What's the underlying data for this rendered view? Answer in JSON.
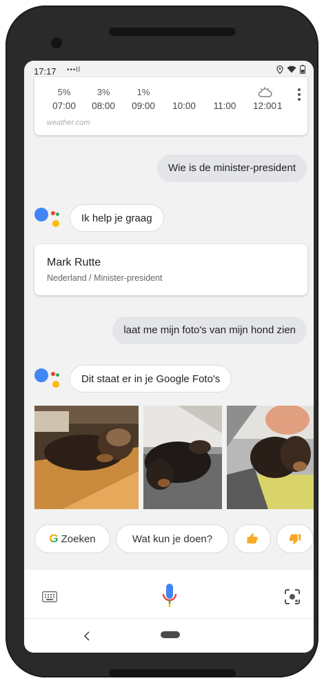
{
  "status_bar": {
    "time": "17:17",
    "signal_dots": "•••ll"
  },
  "weather": {
    "columns": [
      {
        "pct": "5%",
        "hour": "07:00"
      },
      {
        "pct": "3%",
        "hour": "08:00"
      },
      {
        "pct": "1%",
        "hour": "09:00"
      },
      {
        "pct": "",
        "hour": "10:00"
      },
      {
        "pct": "",
        "hour": "11:00"
      },
      {
        "pct": "",
        "hour": "12:00"
      },
      {
        "pct": "",
        "hour": "1"
      }
    ],
    "source": "weather.com"
  },
  "conversation": {
    "user_query_1": "Wie is de minister-president",
    "assistant_reply_1": "Ik help je graag",
    "answer_card": {
      "name": "Mark Rutte",
      "subtitle": "Nederland / Minister-president"
    },
    "user_query_2": "laat me mijn foto's van mijn hond zien",
    "assistant_reply_2": "Dit staat er in je Google Foto's"
  },
  "suggestions": {
    "search_label": "Zoeken",
    "what_can_you_do_label": "Wat kun je doen?"
  },
  "colors": {
    "google_blue": "#4285F4",
    "google_red": "#EA4335",
    "google_yellow": "#FBBC05",
    "google_green": "#34A853",
    "thumb_orange": "#F9A825",
    "user_bubble": "#e3e5e8"
  },
  "icons": [
    "google-g-icon",
    "thumbs-up-icon",
    "thumbs-down-icon",
    "keyboard-icon",
    "microphone-icon",
    "lens-icon",
    "back-icon",
    "home-pill-icon",
    "location-icon",
    "wifi-icon",
    "battery-icon"
  ]
}
